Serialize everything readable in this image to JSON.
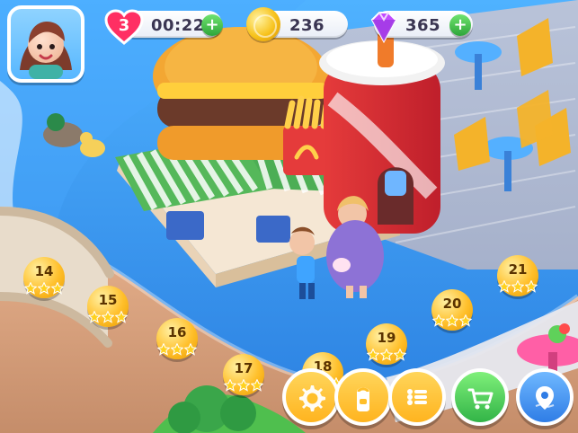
{
  "hud": {
    "lives": "3",
    "timer": "00:22",
    "coins": "236",
    "gems": "365",
    "plus_label": "+"
  },
  "levels": [
    {
      "num": "14"
    },
    {
      "num": "15"
    },
    {
      "num": "16"
    },
    {
      "num": "17"
    },
    {
      "num": "18"
    },
    {
      "num": "19"
    },
    {
      "num": "20"
    },
    {
      "num": "21"
    }
  ],
  "buttons": [
    {
      "name": "settings",
      "icon": "gear-icon"
    },
    {
      "name": "bag",
      "icon": "backpack-icon"
    },
    {
      "name": "menu",
      "icon": "list-icon"
    },
    {
      "name": "shop",
      "icon": "cart-icon"
    },
    {
      "name": "map",
      "icon": "map-pin-icon"
    }
  ],
  "colors": {
    "water": "#2f8fe6",
    "path": "#d3a07b",
    "grass": "#52b84b",
    "button_yellow": "#ffbf2a",
    "button_green": "#49c64a",
    "button_blue": "#2f7de6"
  }
}
